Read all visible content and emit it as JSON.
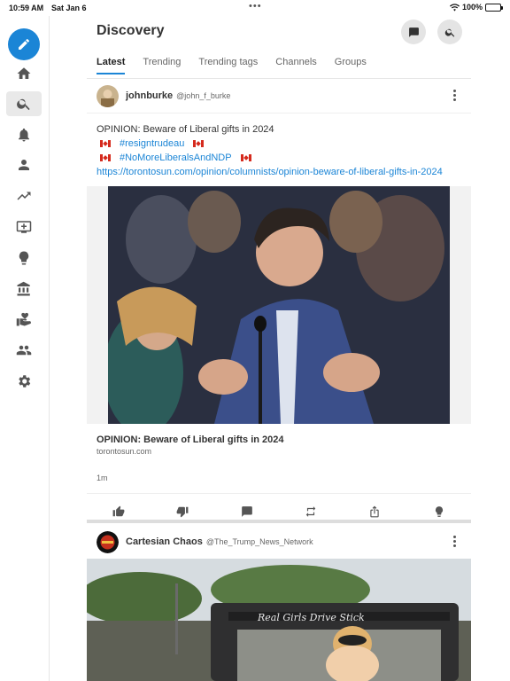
{
  "status_bar": {
    "time": "10:59 AM",
    "date": "Sat Jan 6",
    "battery": "100%"
  },
  "header": {
    "title": "Discovery"
  },
  "tabs": [
    {
      "label": "Latest",
      "active": true
    },
    {
      "label": "Trending"
    },
    {
      "label": "Trending tags"
    },
    {
      "label": "Channels"
    },
    {
      "label": "Groups"
    }
  ],
  "sidebar": {
    "items": [
      "home-icon",
      "search-icon",
      "bell-icon",
      "person-icon",
      "trending-icon",
      "tv-icon",
      "lightbulb-icon",
      "bank-icon",
      "donate-icon",
      "people-icon",
      "gear-icon"
    ],
    "active": "search-icon"
  },
  "posts": [
    {
      "name": "johnburke",
      "handle": "@john_f_burke",
      "text": "OPINION: Beware of Liberal gifts in 2024",
      "hashtags": [
        "#resigntrudeau",
        "#NoMoreLiberalsAndNDP"
      ],
      "url": "https://torontosun.com/opinion/columnists/opinion-beware-of-liberal-gifts-in-2024",
      "link_title": "OPINION: Beware of Liberal gifts in 2024",
      "link_domain": "torontosun.com",
      "time_ago": "1m"
    },
    {
      "name": "Cartesian Chaos",
      "handle": "@The_Trump_News_Network",
      "image_text": "Real Girls Drive Stick"
    }
  ],
  "colors": {
    "accent": "#1b85d6"
  }
}
